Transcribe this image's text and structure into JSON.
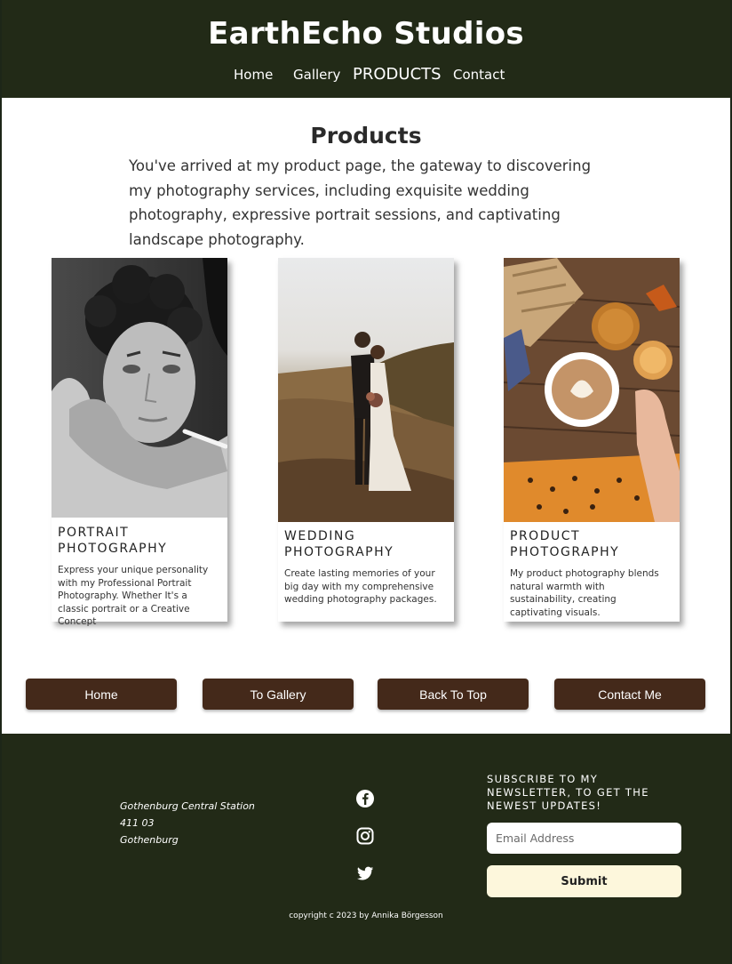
{
  "header": {
    "brand": "EarthEcho Studios",
    "nav": {
      "home": "Home",
      "gallery": "Gallery",
      "products": "PRODUCTS",
      "contact": "Contact"
    }
  },
  "main": {
    "title": "Products",
    "intro": "You've arrived at my product page, the gateway to discovering my photography services, including exquisite wedding photography, expressive portrait sessions, and captivating landscape photography.",
    "cards": [
      {
        "title_line1": "PORTRAIT",
        "title_line2": "PHOTOGRAPHY",
        "text": "Express your unique personality with my Professional Portrait Photography. Whether It's a classic portrait or a Creative Concept"
      },
      {
        "title_line1": "WEDDING",
        "title_line2": "PHOTOGRAPHY",
        "text": "Create lasting memories of your big day with my comprehensive wedding photography packages."
      },
      {
        "title_line1": "PRODUCT",
        "title_line2": "PHOTOGRAPHY",
        "text": "My product photography blends natural warmth with sustainability, creating captivating visuals."
      }
    ]
  },
  "buttons": {
    "home": "Home",
    "gallery": "To Gallery",
    "top": "Back To Top",
    "contact": "Contact Me"
  },
  "footer": {
    "address": [
      "Gothenburg Central Station",
      "411 03",
      "Gothenburg"
    ],
    "social": [
      "facebook-icon",
      "instagram-icon",
      "twitter-icon"
    ],
    "newsletter_title": "SUBSCRIBE TO MY NEWSLETTER, TO GET THE NEWEST UPDATES!",
    "email_placeholder": "Email Address",
    "submit_label": "Submit",
    "copyright": "copyright c 2023 by Annika Börgesson"
  },
  "colors": {
    "dark_green": "#222a17",
    "button_brown": "#44291a",
    "submit_cream": "#fdf7dc"
  }
}
